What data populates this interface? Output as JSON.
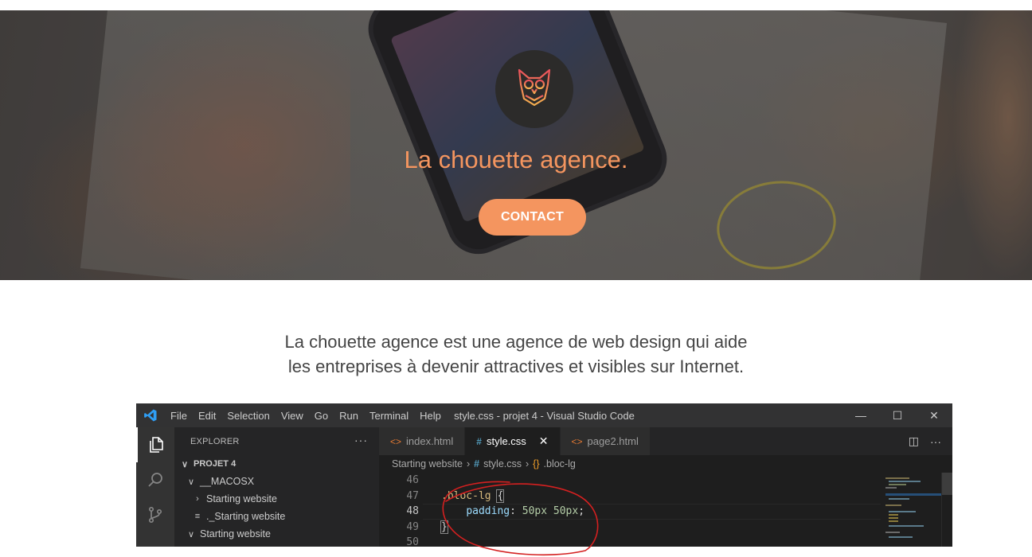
{
  "hero": {
    "title": "La chouette agence.",
    "contact_label": "CONTACT",
    "accent_color": "#f4955f"
  },
  "intro": {
    "line1": "La chouette agence est une agence de web design qui aide",
    "line2": "les entreprises à devenir attractives et visibles sur Internet."
  },
  "vscode": {
    "menu": [
      "File",
      "Edit",
      "Selection",
      "View",
      "Go",
      "Run",
      "Terminal",
      "Help"
    ],
    "window_title": "style.css - projet 4 - Visual Studio Code",
    "controls": {
      "minimize": "—",
      "maximize": "☐",
      "close": "✕"
    },
    "explorer": {
      "header": "EXPLORER",
      "more": "···",
      "project": "PROJET 4",
      "items": [
        {
          "label": "__MACOSX",
          "chevron": "∨"
        },
        {
          "label": "Starting website",
          "chevron": "›"
        },
        {
          "label": "._Starting website",
          "chevron": "≡"
        },
        {
          "label": "Starting website",
          "chevron": "∨"
        }
      ]
    },
    "tabs": [
      {
        "icon": "<>",
        "label": "index.html",
        "active": false
      },
      {
        "icon": "#",
        "label": "style.css",
        "active": true,
        "close": "✕"
      },
      {
        "icon": "<>",
        "label": "page2.html",
        "active": false
      }
    ],
    "tab_actions": {
      "split": "◫",
      "more": "···"
    },
    "breadcrumbs": {
      "folder": "Starting website",
      "file_icon": "#",
      "file": "style.css",
      "symbol_icon": "{}",
      "symbol": ".bloc-lg",
      "sep": "›"
    },
    "code": {
      "lines": [
        {
          "number": "46",
          "selector": "",
          "brace": "",
          "prop": "",
          "value": ""
        },
        {
          "number": "47",
          "selector": ".bloc-lg",
          "brace": "{"
        },
        {
          "number": "48",
          "prop": "padding",
          "colon": ": ",
          "value": "50px 50px",
          "semi": ";"
        },
        {
          "number": "49",
          "brace": "}"
        },
        {
          "number": "50"
        }
      ]
    },
    "icons": {
      "logo": "vscode-logo-icon",
      "explorer": "files-icon",
      "search": "search-icon",
      "scm": "source-control-icon"
    }
  }
}
